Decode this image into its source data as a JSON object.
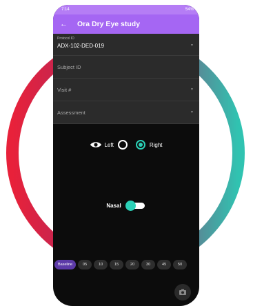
{
  "colors": {
    "accent": "#a566f3",
    "teal": "#2bd1b7",
    "ring_start": "#e8213a",
    "ring_end": "#30c3b1"
  },
  "status": {
    "time": "7:14",
    "right": "54%"
  },
  "appbar": {
    "back_icon": "arrow-left-icon",
    "title": "Ora Dry Eye study"
  },
  "form": {
    "protocol_label": "Protocol ID",
    "protocol_value": "ADX-102-DED-019",
    "subject_placeholder": "Subject ID",
    "visit_placeholder": "Visit #",
    "assessment_placeholder": "Assessment"
  },
  "eye": {
    "icon": "eye-icon",
    "left_label": "Left",
    "right_label": "Right",
    "selected": "Right"
  },
  "nasal": {
    "label": "Nasal",
    "on": true
  },
  "timepoints": {
    "items": [
      "Baseline",
      "05",
      "10",
      "15",
      "20",
      "30",
      "45",
      "50"
    ],
    "selected": "Baseline"
  },
  "camera": {
    "icon": "camera-icon"
  }
}
